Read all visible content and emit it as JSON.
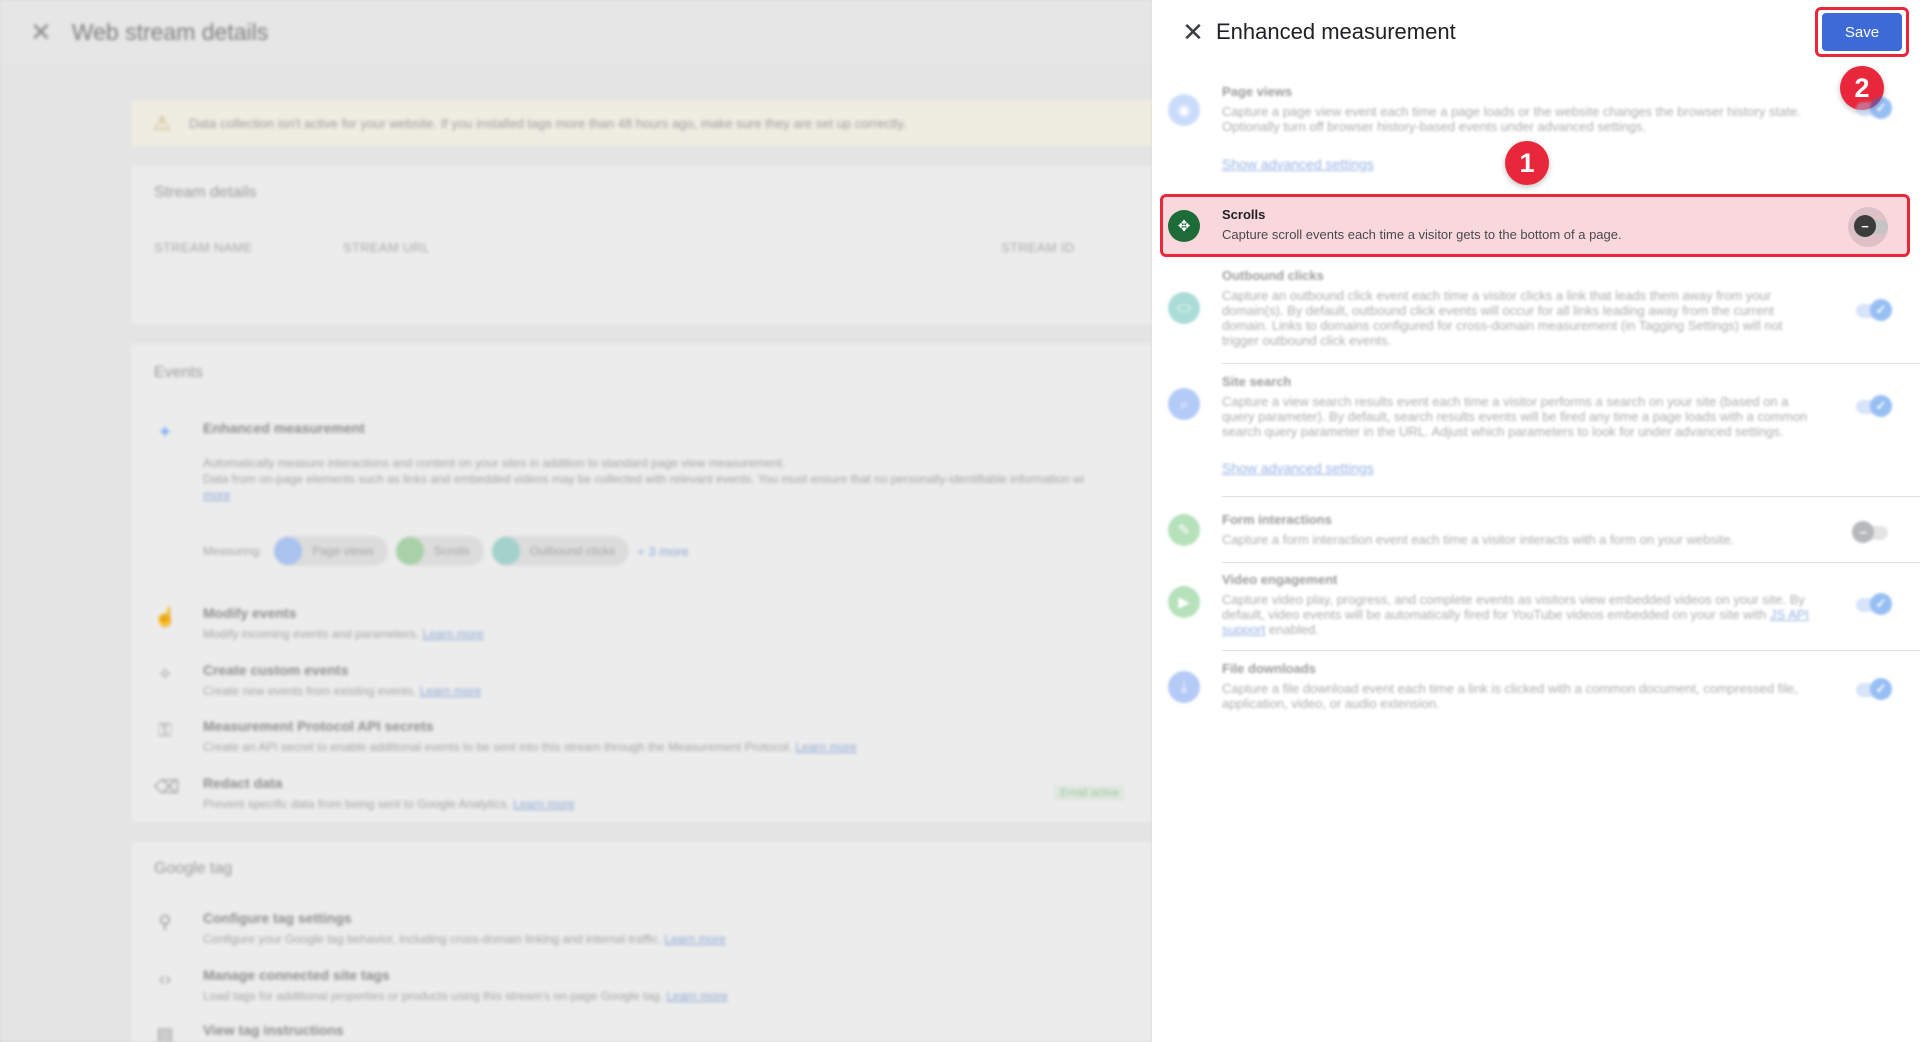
{
  "background": {
    "header_title": "Web stream details",
    "warning_text": "Data collection isn't active for your website. If you installed tags more than 48 hours ago, make sure they are set up correctly.",
    "stream_details_title": "Stream details",
    "columns": [
      "STREAM NAME",
      "STREAM URL",
      "STREAM ID"
    ],
    "events_title": "Events",
    "enhanced": {
      "title": "Enhanced measurement",
      "desc_1": "Automatically measure interactions and content on your sites in addition to standard page view measurement.",
      "desc_2": "Data from on-page elements such as links and embedded videos may be collected with relevant events. You must ensure that no personally-identifiable information wi",
      "learn_more": "more",
      "measuring_label": "Measuring:",
      "chips": [
        "Page views",
        "Scrolls",
        "Outbound clicks"
      ],
      "more_link": "+ 3 more"
    },
    "rows": [
      {
        "title": "Modify events",
        "desc": "Modify incoming events and parameters.",
        "link": "Learn more"
      },
      {
        "title": "Create custom events",
        "desc": "Create new events from existing events.",
        "link": "Learn more"
      },
      {
        "title": "Measurement Protocol API secrets",
        "desc": "Create an API secret to enable additional events to be sent into this stream through the Measurement Protocol.",
        "link": "Learn more"
      },
      {
        "title": "Redact data",
        "desc": "Prevent specific data from being sent to Google Analytics.",
        "link": "Learn more",
        "badge": "Email active"
      }
    ],
    "google_tag_title": "Google tag",
    "tag_rows": [
      {
        "title": "Configure tag settings",
        "desc": "Configure your Google tag behavior, including cross-domain linking and internal traffic.",
        "link": "Learn more"
      },
      {
        "title": "Manage connected site tags",
        "desc": "Load tags for additional properties or products using this stream's on-page Google tag.",
        "link": "Learn more"
      },
      {
        "title": "View tag instructions",
        "desc": "",
        "link": ""
      }
    ]
  },
  "drawer": {
    "title": "Enhanced measurement",
    "save_label": "Save",
    "step_badges": [
      "1",
      "2"
    ],
    "items": [
      {
        "name": "Page views",
        "desc": "Capture a page view event each time a page loads or the website changes the browser history state. Optionally turn off browser history-based events under advanced settings.",
        "advanced": "Show advanced settings",
        "icon": "eye-icon",
        "color": "#8ab4f8",
        "enabled": true
      },
      {
        "name": "Scrolls",
        "desc": "Capture scroll events each time a visitor gets to the bottom of a page.",
        "icon": "scroll-arrows-icon",
        "color": "#1e6b3a",
        "enabled": false
      },
      {
        "name": "Outbound clicks",
        "desc": "Capture an outbound click event each time a visitor clicks a link that leads them away from your domain(s). By default, outbound click events will occur for all links leading away from the current domain. Links to domains configured for cross-domain measurement (in Tagging Settings) will not trigger outbound click events.",
        "icon": "mouse-icon",
        "color": "#4ab3a9",
        "enabled": true
      },
      {
        "name": "Site search",
        "desc": "Capture a view search results event each time a visitor performs a search on your site (based on a query parameter). By default, search results events will be fired any time a page loads with a common search query parameter in the URL. Adjust which parameters to look for under advanced settings.",
        "advanced": "Show advanced settings",
        "icon": "search-icon",
        "color": "#5b8def",
        "enabled": true
      },
      {
        "name": "Form interactions",
        "desc": "Capture a form interaction event each time a visitor interacts with a form on your website.",
        "icon": "form-icon",
        "color": "#5fbf6a",
        "enabled": false
      },
      {
        "name": "Video engagement",
        "desc_before_link": "Capture video play, progress, and complete events as visitors view embedded videos on your site. By default, video events will be automatically fired for YouTube videos embedded on your site with ",
        "link": "JS API support",
        "desc_after_link": " enabled.",
        "icon": "play-icon",
        "color": "#5fbf6a",
        "enabled": true
      },
      {
        "name": "File downloads",
        "desc": "Capture a file download event each time a link is clicked with a common document, compressed file, application, video, or audio extension.",
        "icon": "download-icon",
        "color": "#5b8def",
        "enabled": true
      }
    ]
  }
}
